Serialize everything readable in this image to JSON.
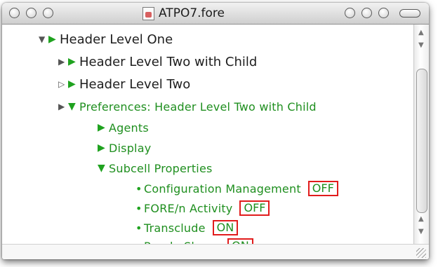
{
  "window": {
    "title": "ATPO7.fore"
  },
  "outline": {
    "level1": {
      "label": "Header Level One"
    },
    "child1": {
      "label": "Header Level Two with Child"
    },
    "child2": {
      "label": "Header Level Two"
    },
    "preferences": {
      "label": "Preferences: Header Level Two with Child",
      "agents": "Agents",
      "display": "Display",
      "subcell": "Subcell Properties",
      "items": [
        {
          "label": "Configuration Management",
          "value": "OFF"
        },
        {
          "label": "FORE/n Activity",
          "value": "OFF"
        },
        {
          "label": "Transclude",
          "value": "ON"
        },
        {
          "label": "Purple Slurpy",
          "value": "ON"
        }
      ]
    }
  },
  "glyphs": {
    "tri_down": "▼",
    "tri_right": "▶",
    "tri_open": "▷",
    "bullet": "•",
    "up": "▲",
    "down": "▼"
  }
}
